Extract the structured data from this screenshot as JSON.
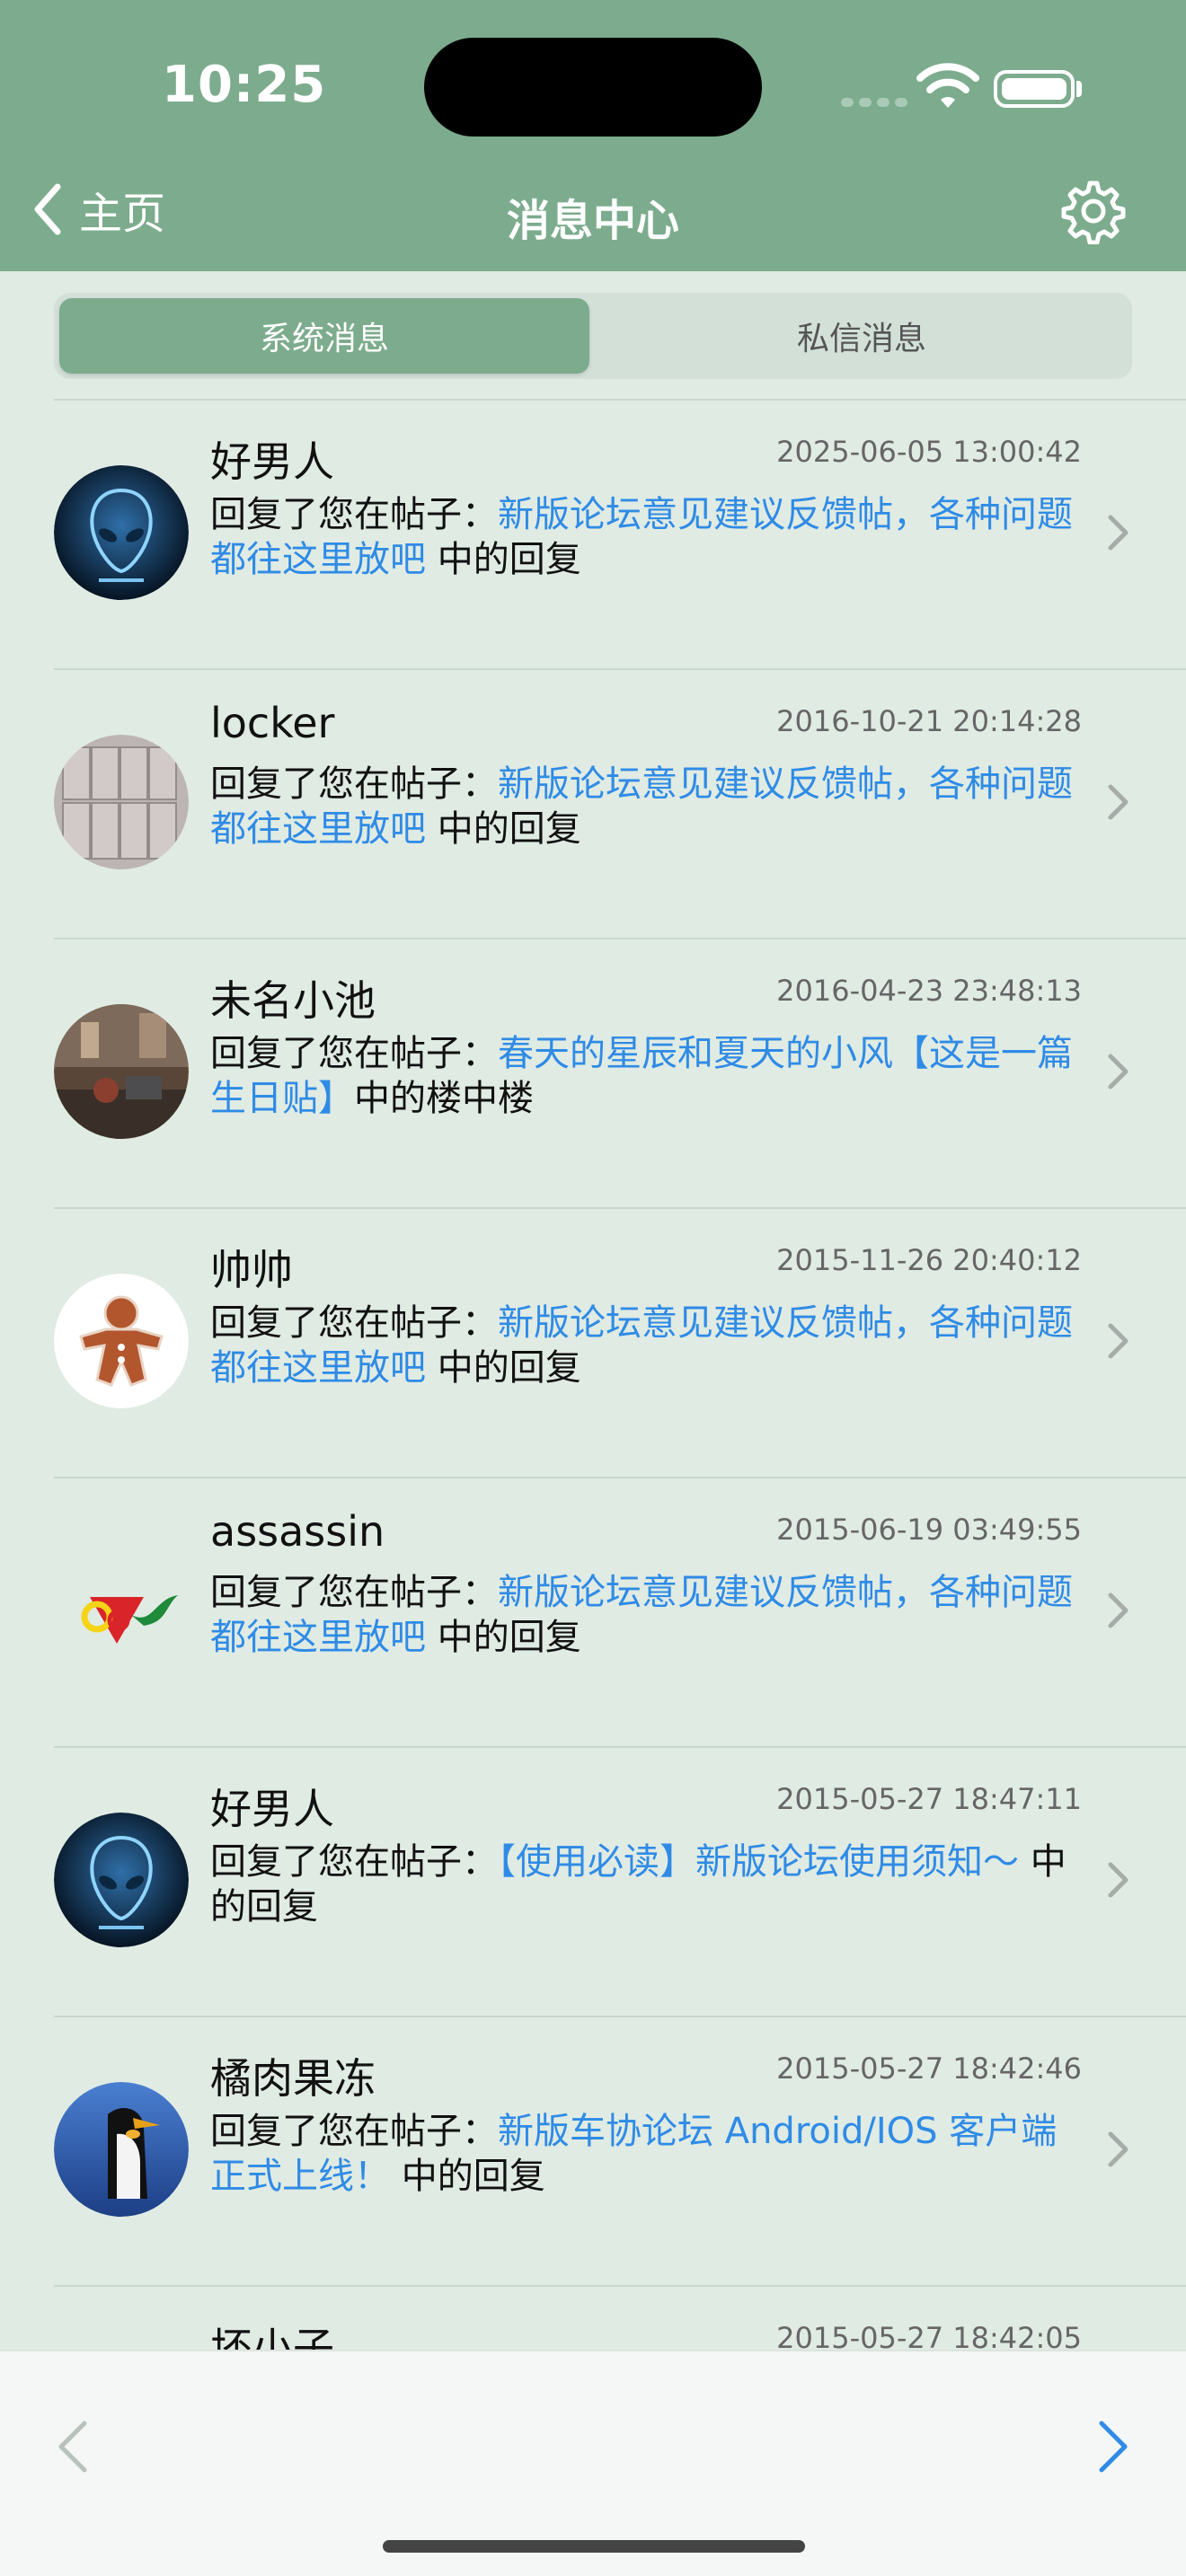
{
  "status": {
    "time": "10:25"
  },
  "nav": {
    "back_label": "主页",
    "title": "消息中心"
  },
  "tabs": {
    "system": "系统消息",
    "private": "私信消息"
  },
  "messages": [
    {
      "name": "好男人",
      "time": "2025-06-05 13:00:42",
      "prefix": "回复了您在帖子：",
      "link": "新版论坛意见建议反馈帖，各种问题都往这里放吧",
      "suffix": " 中的回复",
      "avatar": "alien-avatar"
    },
    {
      "name": "locker",
      "time": "2016-10-21 20:14:28",
      "prefix": "回复了您在帖子：",
      "link": "新版论坛意见建议反馈帖，各种问题都往这里放吧",
      "suffix": " 中的回复",
      "avatar": "locker-avatar"
    },
    {
      "name": "未名小池",
      "time": "2016-04-23 23:48:13",
      "prefix": "回复了您在帖子：",
      "link": "春天的星辰和夏天的小风【这是一篇生日贴】",
      "suffix": "中的楼中楼",
      "avatar": "street-avatar"
    },
    {
      "name": "帅帅",
      "time": "2015-11-26 20:40:12",
      "prefix": "回复了您在帖子：",
      "link": "新版论坛意见建议反馈帖，各种问题都往这里放吧",
      "suffix": " 中的回复",
      "avatar": "gingerbread-avatar"
    },
    {
      "name": "assassin",
      "time": "2015-06-19 03:49:55",
      "prefix": "回复了您在帖子：",
      "link": "新版论坛意见建议反馈帖，各种问题都往这里放吧",
      "suffix": " 中的回复",
      "avatar": "logo-avatar"
    },
    {
      "name": "好男人",
      "time": "2015-05-27 18:47:11",
      "prefix": "回复了您在帖子：",
      "link": "【使用必读】新版论坛使用须知～",
      "suffix": " 中的回复",
      "avatar": "alien-avatar"
    },
    {
      "name": "橘肉果冻",
      "time": "2015-05-27 18:42:46",
      "prefix": "回复了您在帖子：",
      "link": "新版车协论坛 Android/IOS 客户端正式上线！",
      "suffix": "  中的回复",
      "avatar": "penguin-avatar"
    },
    {
      "name": "坏小子",
      "time": "2015-05-27 18:42:05",
      "prefix": "",
      "link": "",
      "suffix": "",
      "avatar": ""
    }
  ],
  "colors": {
    "accent": "#7cac8d",
    "background": "#e0ebe3",
    "link": "#2f8be6"
  },
  "icons": {
    "back": "chevron-left-icon",
    "settings": "gear-icon",
    "row": "chevron-right-icon",
    "prev": "chevron-left-icon",
    "next": "chevron-right-icon"
  }
}
